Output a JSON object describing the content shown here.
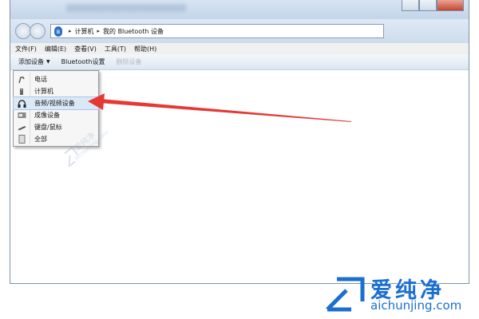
{
  "address": {
    "crumbs": [
      "计算机",
      "我的 Bluetooth 设备"
    ]
  },
  "menubar": {
    "items": [
      "文件(F)",
      "编辑(E)",
      "查看(V)",
      "工具(T)",
      "帮助(H)"
    ]
  },
  "toolbar": {
    "add_device": "添加设备",
    "bluetooth_settings": "Bluetooth设置",
    "delete_device": "删除设备"
  },
  "dropdown": {
    "items": [
      {
        "label": "电话",
        "icon": "phone-icon"
      },
      {
        "label": "计算机",
        "icon": "computer-icon"
      },
      {
        "label": "音频/视频设备",
        "icon": "headphones-icon",
        "highlighted": true
      },
      {
        "label": "成像设备",
        "icon": "imaging-device-icon"
      },
      {
        "label": "键盘/鼠标",
        "icon": "keyboard-mouse-icon"
      },
      {
        "label": "全部",
        "icon": "all-devices-icon"
      }
    ]
  },
  "annotation": {
    "color": "#e53935"
  },
  "watermark": {
    "text_cn": "爱纯净",
    "text_en": "aichunjing.com",
    "color": "#1b6fcf"
  }
}
